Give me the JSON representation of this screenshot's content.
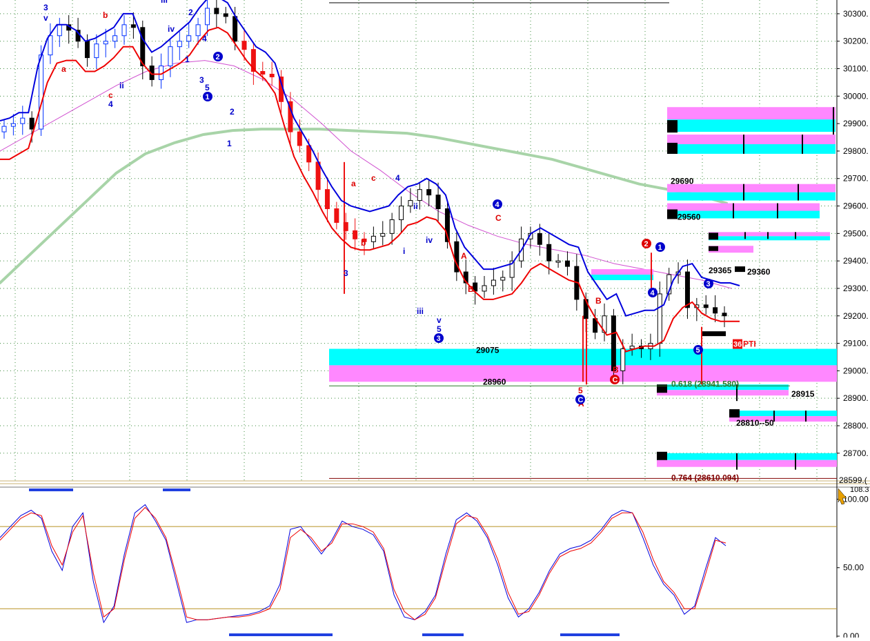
{
  "chart_data": {
    "type": "candlestick",
    "ylim": [
      28599,
      30350
    ],
    "grid": true,
    "axis": {
      "ticks": [
        {
          "value": 30300,
          "label": "30300."
        },
        {
          "value": 30200,
          "label": "30200."
        },
        {
          "value": 30100,
          "label": "30100."
        },
        {
          "value": 30000,
          "label": "30000."
        },
        {
          "value": 29900,
          "label": "29900."
        },
        {
          "value": 29800,
          "label": "29800."
        },
        {
          "value": 29700,
          "label": "29700."
        },
        {
          "value": 29600,
          "label": "29600."
        },
        {
          "value": 29500,
          "label": "29500."
        },
        {
          "value": 29400,
          "label": "29400."
        },
        {
          "value": 29300,
          "label": "29300."
        },
        {
          "value": 29200,
          "label": "29200."
        },
        {
          "value": 29100,
          "label": "29100."
        },
        {
          "value": 29000,
          "label": "29000."
        },
        {
          "value": 28900,
          "label": "28900."
        },
        {
          "value": 28800,
          "label": "28800."
        },
        {
          "value": 28700,
          "label": "28700."
        }
      ],
      "bottom_value_label": "28599.("
    },
    "price_labels": [
      {
        "text": "29690",
        "value": 29690
      },
      {
        "text": "29560",
        "value": 29560
      },
      {
        "text": "29365",
        "value": 29365
      },
      {
        "text": "29360",
        "value": 29360
      },
      {
        "text": "29075",
        "value": 29075
      },
      {
        "text": "28960",
        "value": 28960
      },
      {
        "text": "28915",
        "value": 28915
      },
      {
        "text": "28810--50",
        "value": 28810
      }
    ],
    "fib_levels": [
      {
        "label": "0.618 (28941.580)",
        "value": 28941.58
      },
      {
        "label": "0.764 (28610.094)",
        "value": 28610.094
      }
    ],
    "other_labels": [
      "36",
      "PTI"
    ],
    "wave_labels": [
      "3",
      "v",
      "iii",
      "v",
      "2",
      "b",
      "a",
      "iv",
      "c",
      "4",
      "ii",
      "1",
      "4",
      "3",
      "5",
      "2",
      "1",
      "2",
      "1",
      "a",
      "c",
      "4",
      "b",
      "3",
      "ii",
      "iv",
      "i",
      "iii",
      "v",
      "5",
      "3",
      "4",
      "C",
      "A",
      "B",
      "A",
      "B",
      "5",
      "C",
      "B",
      "C",
      "2",
      "1",
      "4",
      "3",
      "5"
    ],
    "series": [
      {
        "name": "",
        "values": [
          29890,
          29900,
          29920,
          29880,
          30150,
          30220,
          30260,
          30240,
          30200,
          30140,
          30190,
          30200,
          30220,
          30260,
          30250,
          30110,
          30060,
          30110,
          30180,
          30200,
          30220,
          30260,
          30320,
          30300,
          30290,
          30200,
          30170,
          30090,
          30080,
          30070,
          29980,
          29870,
          29820,
          29760,
          29660,
          29590,
          29540,
          29510,
          29480,
          29470,
          29490,
          29500,
          29550,
          29600,
          29620,
          29660,
          29640,
          29590,
          29470,
          29360,
          29320,
          29290,
          29310,
          29330,
          29340,
          29400,
          29480,
          29500,
          29460,
          29400,
          29400,
          29380,
          29260,
          29190,
          29140,
          29200,
          29000,
          29080,
          29090,
          29080,
          29100,
          29280,
          29350,
          29360,
          29230,
          29240,
          29230,
          29210,
          29200
        ]
      },
      {
        "name": "",
        "values": [
          29850,
          29860,
          29880,
          29880,
          30050,
          30150,
          30200,
          30200,
          30180,
          30140,
          30150,
          30170,
          30190,
          30240,
          30240,
          30150,
          30100,
          30120,
          30150,
          30180,
          30210,
          30260,
          30300,
          30300,
          30280,
          30220,
          30170,
          30120,
          30100,
          30060,
          29950,
          29860,
          29800,
          29740,
          29670,
          29610,
          29560,
          29540,
          29530,
          29520,
          29530,
          29540,
          29580,
          29610,
          29620,
          29640,
          29620,
          29580,
          29460,
          29390,
          29350,
          29310,
          29310,
          29320,
          29330,
          29380,
          29440,
          29460,
          29440,
          29420,
          29400,
          29390,
          29300,
          29250,
          29200,
          29220,
          29140,
          29150,
          29160,
          29160,
          29180,
          29270,
          29320,
          29330,
          29280,
          29270,
          29260,
          29260,
          29250
        ]
      },
      {
        "name": "",
        "values": [
          29800,
          29800,
          29820,
          29840,
          29960,
          30080,
          30150,
          30160,
          30160,
          30120,
          30120,
          30140,
          30170,
          30210,
          30210,
          30150,
          30110,
          30110,
          30130,
          30150,
          30180,
          30230,
          30270,
          30280,
          30260,
          30210,
          30160,
          30120,
          30090,
          30040,
          29920,
          29810,
          29740,
          29680,
          29610,
          29550,
          29510,
          29480,
          29470,
          29470,
          29480,
          29490,
          29520,
          29560,
          29570,
          29590,
          29580,
          29540,
          29430,
          29360,
          29320,
          29290,
          29290,
          29300,
          29310,
          29350,
          29400,
          29420,
          29400,
          29380,
          29360,
          29350,
          29270,
          29210,
          29160,
          29170,
          29100,
          29110,
          29120,
          29120,
          29140,
          29220,
          29260,
          29280,
          29240,
          29220,
          29210,
          29210,
          29210
        ]
      }
    ],
    "oscillator": {
      "ylim": [
        0,
        108.3
      ],
      "ticks": [
        {
          "value": 100,
          "label": "100.00"
        },
        {
          "value": 50,
          "label": "50.00"
        },
        {
          "value": 0,
          "label": "0.00"
        }
      ],
      "top_value_label": "108.3",
      "series": [
        {
          "name": "",
          "values": [
            72,
            80,
            88,
            92,
            86,
            62,
            48,
            80,
            90,
            40,
            10,
            22,
            60,
            90,
            96,
            84,
            70,
            40,
            10,
            12,
            12,
            13,
            14,
            15,
            16,
            18,
            22,
            38,
            78,
            80,
            70,
            60,
            70,
            84,
            80,
            78,
            74,
            62,
            30,
            14,
            12,
            18,
            30,
            60,
            85,
            90,
            84,
            72,
            52,
            28,
            14,
            20,
            32,
            48,
            60,
            64,
            66,
            70,
            78,
            88,
            92,
            90,
            72,
            52,
            38,
            30,
            16,
            22,
            48,
            72,
            66
          ]
        },
        {
          "name": "",
          "values": [
            70,
            78,
            86,
            90,
            88,
            66,
            52,
            76,
            88,
            46,
            14,
            20,
            56,
            86,
            94,
            86,
            72,
            44,
            14,
            12,
            12,
            13,
            14,
            14,
            15,
            17,
            20,
            34,
            72,
            78,
            72,
            62,
            68,
            82,
            82,
            80,
            76,
            64,
            34,
            18,
            12,
            16,
            28,
            56,
            82,
            88,
            86,
            74,
            56,
            32,
            16,
            18,
            30,
            46,
            58,
            62,
            64,
            68,
            76,
            86,
            90,
            90,
            76,
            56,
            40,
            32,
            20,
            20,
            44,
            70,
            68
          ]
        }
      ]
    }
  }
}
